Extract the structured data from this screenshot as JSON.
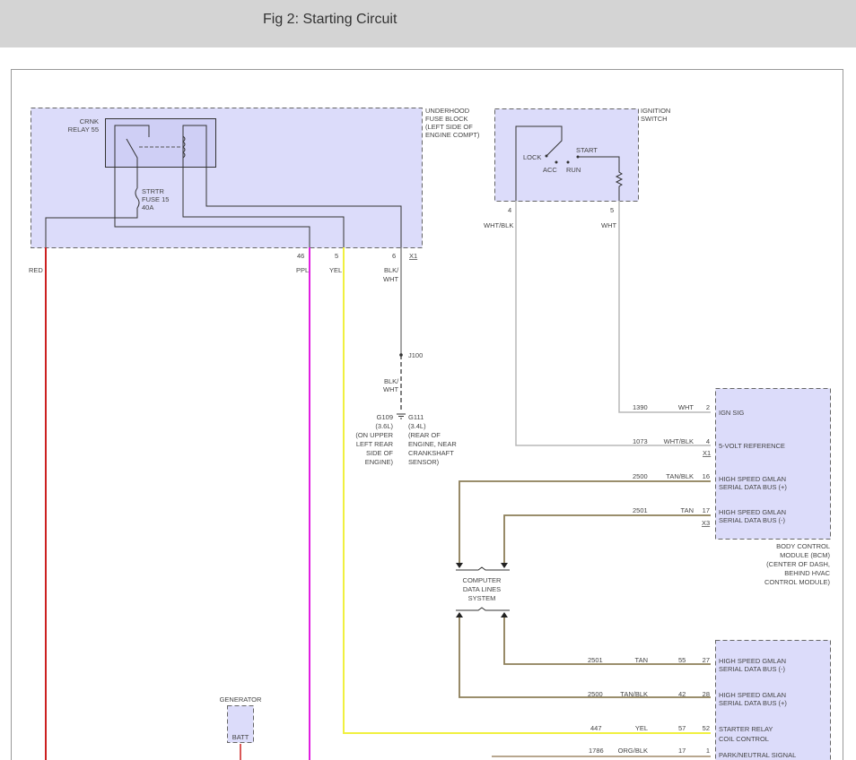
{
  "header": {
    "title": "Fig 2: Starting Circuit"
  },
  "fuse_block": {
    "label": [
      "UNDERHOOD",
      "FUSE BLOCK",
      "(LEFT SIDE OF",
      "ENGINE COMPT)"
    ],
    "relay": [
      "CRNK",
      "RELAY 55"
    ],
    "fuse": [
      "STRTR",
      "FUSE 15",
      "40A"
    ],
    "pins": {
      "p46": "46",
      "p5": "5",
      "p6": "6",
      "connector": "X1"
    },
    "wires": {
      "red": "RED",
      "ppl": "PPL",
      "yel": "YEL",
      "blkwht1": "BLK/",
      "blkwht2": "WHT"
    }
  },
  "splice": {
    "label": "J100",
    "wire1": "BLK/",
    "wire2": "WHT"
  },
  "grounds": {
    "g109": [
      "G109",
      "(3.6L)",
      "(ON UPPER",
      "LEFT REAR",
      "SIDE OF",
      "ENGINE)"
    ],
    "g111": [
      "G111",
      "(3.4L)",
      "(REAR OF",
      "ENGINE, NEAR",
      "CRANKSHAFT",
      "SENSOR)"
    ]
  },
  "ignition": {
    "label": [
      "IGNITION",
      "SWITCH"
    ],
    "positions": {
      "lock": "LOCK",
      "acc": "ACC",
      "run": "RUN",
      "start": "START"
    },
    "pins": {
      "p4": "4",
      "p5": "5"
    },
    "wires": {
      "w4": "WHT/BLK",
      "w5": "WHT"
    }
  },
  "bcm": {
    "label": [
      "BODY CONTROL",
      "MODULE (BCM)",
      "(CENTER OF DASH,",
      "BEHIND HVAC",
      "CONTROL MODULE)"
    ],
    "rows": [
      {
        "circuit": "1390",
        "color": "WHT",
        "pin": "2",
        "text1": "IGN SIG",
        "text2": ""
      },
      {
        "circuit": "1073",
        "color": "WHT/BLK",
        "pin": "4",
        "text1": "5-VOLT REFERENCE",
        "text2": "",
        "connector": "X1"
      },
      {
        "circuit": "2500",
        "color": "TAN/BLK",
        "pin": "16",
        "text1": "HIGH SPEED GMLAN",
        "text2": "SERIAL DATA BUS (+)"
      },
      {
        "circuit": "2501",
        "color": "TAN",
        "pin": "17",
        "text1": "HIGH SPEED GMLAN",
        "text2": "SERIAL DATA BUS (-)",
        "connector": "X3"
      }
    ]
  },
  "data_lines": {
    "label": [
      "COMPUTER",
      "DATA LINES",
      "SYSTEM"
    ]
  },
  "module2": {
    "rows": [
      {
        "circuit": "2501",
        "color": "TAN",
        "pin_a": "55",
        "pin_b": "27",
        "text1": "HIGH SPEED GMLAN",
        "text2": "SERIAL DATA BUS (-)"
      },
      {
        "circuit": "2500",
        "color": "TAN/BLK",
        "pin_a": "42",
        "pin_b": "28",
        "text1": "HIGH SPEED GMLAN",
        "text2": "SERIAL DATA BUS (+)"
      },
      {
        "circuit": "447",
        "color": "YEL",
        "pin_a": "57",
        "pin_b": "52",
        "text1": "STARTER RELAY",
        "text2": "COIL CONTROL"
      },
      {
        "circuit": "1786",
        "color": "ORG/BLK",
        "pin_a": "17",
        "pin_b": "1",
        "text1": "PARK/NEUTRAL SIGNAL",
        "text2": ""
      }
    ]
  },
  "generator": {
    "label": "GENERATOR",
    "pin": "BATT"
  },
  "colors": {
    "red": "#cc2020",
    "ppl": "#e020e0",
    "yel": "#f0f040",
    "tan": "#8c7e58",
    "module_fill": "#dcdcfa"
  }
}
